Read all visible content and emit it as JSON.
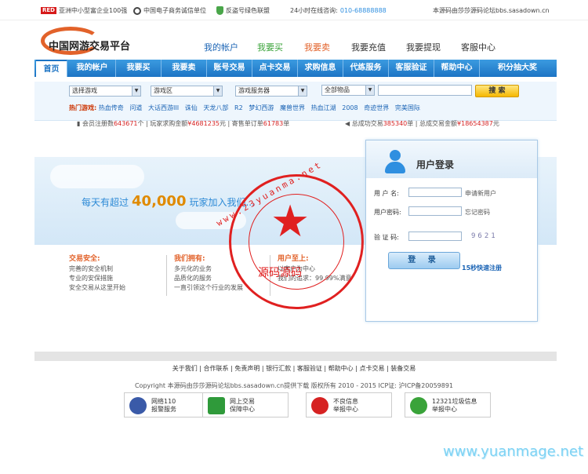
{
  "topbar": {
    "badge": "RED",
    "award": "亚洲中小型富企业100强",
    "ecommerce": "中国电子商务诚信单位",
    "green": "反盗号绿色联盟",
    "hotline_label": "24小时在线咨询:",
    "hotline": "010-68888888",
    "source": "本源码由莎莎源码论坛bbs.sasadown.cn"
  },
  "logo": {
    "text": "中国网游交易平台"
  },
  "quicknav": {
    "items": [
      {
        "label": "我的帐户",
        "color": "#1b64b5"
      },
      {
        "label": "我要买",
        "color": "#3aa33a"
      },
      {
        "label": "我要卖",
        "color": "#e2622a"
      },
      {
        "label": "我要充值",
        "color": "#333333"
      },
      {
        "label": "我要提现",
        "color": "#333333"
      },
      {
        "label": "客服中心",
        "color": "#333333"
      }
    ]
  },
  "mainnav": {
    "tabs": [
      "首页",
      "我的帐户",
      "我要买",
      "我要卖",
      "账号交易",
      "点卡交易",
      "求购信息",
      "代练服务",
      "客服验证",
      "帮助中心",
      "积分抽大奖"
    ]
  },
  "search": {
    "game": "选择游戏",
    "area": "游戏区",
    "server": "游戏服务器",
    "goods": "全部物品",
    "button": "搜 索"
  },
  "hot": {
    "label": "热门游戏:",
    "games": [
      "热血传奇",
      "问道",
      "大话西游III",
      "诛仙",
      "天龙八部",
      "R2",
      "梦幻西游",
      "魔兽世界",
      "热血江湖",
      "2008",
      "奇迹世界",
      "完美国际"
    ]
  },
  "stats": {
    "members_label": "会员注册数",
    "members": "643671",
    "members_unit": "个",
    "deals_label": "玩家求购金额",
    "deals": "¥4681235",
    "deals_unit": "元",
    "orders_label": "寄售单订单",
    "orders": "61783",
    "orders_unit": "单",
    "total_label": "总成功交易",
    "total": "385340",
    "total_unit": "单",
    "amount_label": "总成交易金额",
    "amount": "¥18654387",
    "amount_unit": "元"
  },
  "banner": {
    "prefix": "每天有超过",
    "count": "40,000",
    "suffix": "玩家加入我们..."
  },
  "features": [
    {
      "title": "交易安全:",
      "lines": [
        "完善的安全机制",
        "专业的安保措施",
        "安全交易从这里开始"
      ]
    },
    {
      "title": "我们拥有:",
      "lines": [
        "多元化的业务",
        "品质化的服务",
        "一直引领这个行业的发展"
      ]
    },
    {
      "title": "用户至上:",
      "lines": [
        "以客户为中心",
        "",
        "我们的追求：99.99%满意"
      ]
    }
  ],
  "login": {
    "title": "用户登录",
    "username_label": "用 户 名:",
    "register_link": "申请新用户",
    "password_label": "用户密码:",
    "forgot_link": "忘记密码",
    "captcha_label": "验 证 码:",
    "captcha": "9621",
    "button": "登 录",
    "quick_register": "15秒快速注册"
  },
  "footer": {
    "links": "关于我们 | 合作联系 | 免责声明 | 银行汇款 | 客服验证 | 帮助中心 | 点卡交易 | 装备交易",
    "copyright": "Copyright   本源码由莎莎源码论坛bbs.sasadown.cn提供下载 版权所有    2010 - 2015       ICP证: 沪ICP备20059891",
    "badges": [
      {
        "line1": "网络110",
        "line2": "报警服务"
      },
      {
        "line1": "网上交易",
        "line2": "保障中心"
      },
      {
        "line1": "不良信息",
        "line2": "举报中心"
      },
      {
        "line1": "12321垃圾信息",
        "line2": "举报中心"
      }
    ]
  },
  "watermark": {
    "ring": "www.23yuanma.net",
    "stamp_text": "源码源码",
    "site": "www.yuanmage.net"
  }
}
